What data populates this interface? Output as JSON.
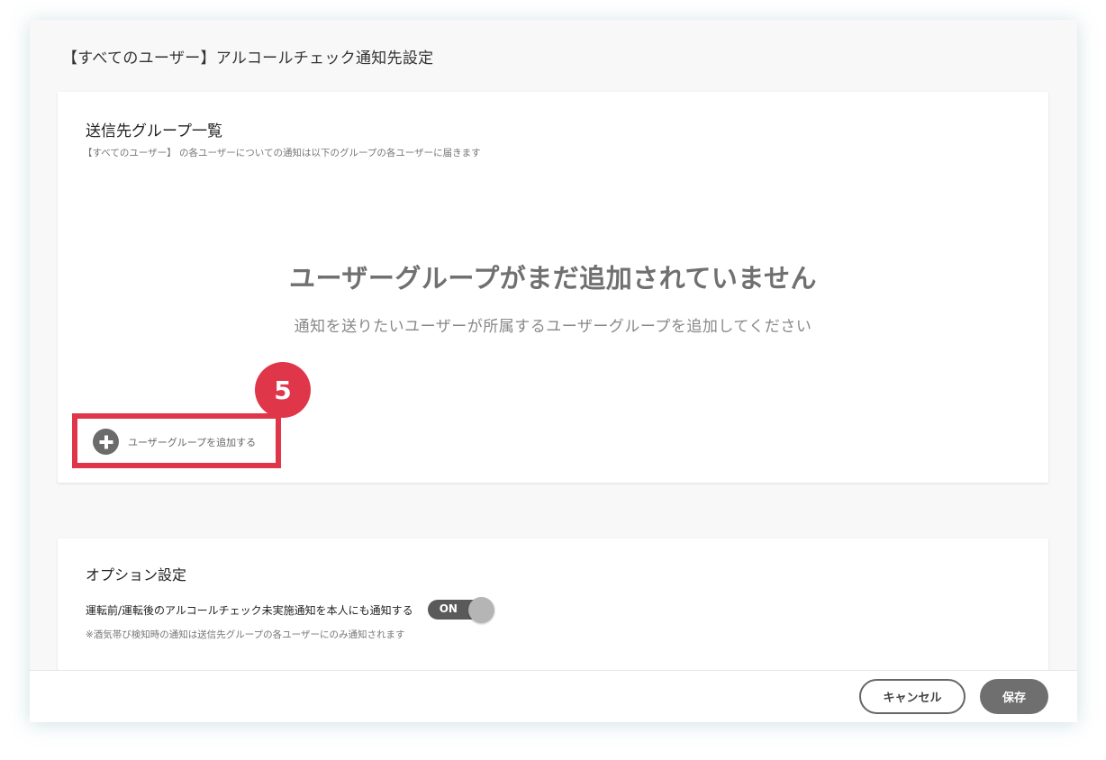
{
  "modal": {
    "title": "【すべてのユーザー】アルコールチェック通知先設定"
  },
  "groups": {
    "heading": "送信先グループ一覧",
    "description": "【すべてのユーザー】 の各ユーザーについての通知は以下のグループの各ユーザーに届きます",
    "empty_title": "ユーザーグループがまだ追加されていません",
    "empty_subtitle": "通知を送りたいユーザーが所属するユーザーグループを追加してください",
    "add_button_label": "ユーザーグループを追加する",
    "add_button_icon": "plus-circle-icon",
    "step_badge": "5",
    "highlight_color": "#e0364a"
  },
  "options": {
    "heading": "オプション設定",
    "notify_label": "運転前/運転後のアルコールチェック未実施通知を本人にも通知する",
    "toggle_state": "ON",
    "note": "※酒気帯び検知時の通知は送信先グループの各ユーザーにのみ通知されます"
  },
  "footer": {
    "cancel_label": "キャンセル",
    "save_label": "保存"
  }
}
